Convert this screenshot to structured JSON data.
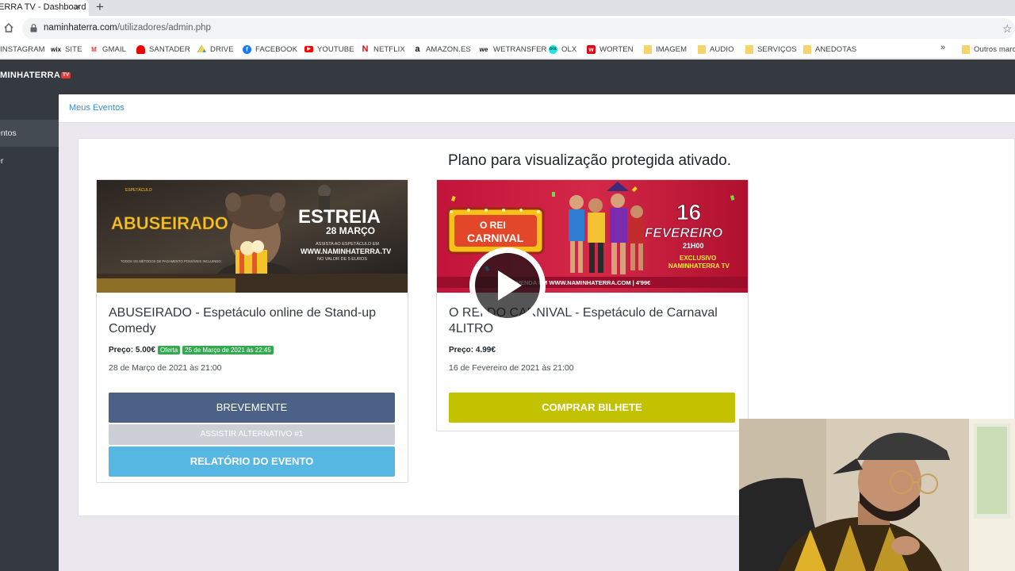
{
  "browser": {
    "tab_title": "ERRA TV - Dashboard",
    "tab_close": "×",
    "new_tab": "+",
    "url_host": "naminhaterra.com",
    "url_path": "/utilizadores/admin.php",
    "bookmarks": [
      "INSTAGRAM",
      "SITE",
      "GMAIL",
      "SANTADER",
      "DRIVE",
      "FACEBOOK",
      "YOUTUBE",
      "NETFLIX",
      "AMAZON.ES",
      "WETRANSFER",
      "OLX",
      "WORTEN",
      "IMAGEM",
      "AUDIO",
      "SERVIÇOS",
      "ANEDOTAS"
    ],
    "bookmarks_more": "»",
    "other_bookmarks": "Outros marc"
  },
  "app": {
    "brand": "MINHATERRA",
    "brand_badge": "TV",
    "sidebar": [
      "entos",
      "er"
    ],
    "breadcrumb": "Meus Eventos",
    "plan_message": "Plano para visualização protegida ativado."
  },
  "events": [
    {
      "title": "ABUSEIRADO - Espetáculo online de Stand-up Comedy",
      "price": "Preço: 5.00€",
      "offer_badge": "Oferta",
      "offer_date": "25 de Março de 2021 às 22:45",
      "date": "28 de Março de 2021 às 21:00",
      "btn_primary": "BREVEMENTE",
      "btn_alt": "ASSISTIR ALTERNATIVO #1",
      "btn_report": "RELATÓRIO DO EVENTO",
      "poster": {
        "title": "ABUSEIRADO",
        "top_label": "ESPETÁCULO",
        "headline": "ESTREIA",
        "subline": "28 MARÇO",
        "small1": "ASSISTA AO ESPETÁCULO EM",
        "site": "WWW.NAMINHATERRA.TV",
        "small2": "NO VALOR DE 5 EUROS",
        "note": "TODOS OS MÉTODOS DE PAGAMENTO POSSÍVEIS INCLUINDO:"
      }
    },
    {
      "title": "O REI DO CARNIVAL - Espetáculo de Carnaval 4LITRO",
      "price": "Preço: 4.99€",
      "date": "16 de Fevereiro de 2021 às 21:00",
      "btn_primary": "COMPRAR BILHETE",
      "poster": {
        "title_top": "O REI",
        "title_bottom": "CARNIVAL",
        "day": "16",
        "month": "FEVEREIRO",
        "time": "21H00",
        "exclusive": "EXCLUSIVO",
        "channel": "NAMINHATERRA TV",
        "site": "VENDA EM WWW.NAMINHATERRA.COM | 4'99€"
      }
    }
  ],
  "colors": {
    "header": "#343a40",
    "link": "#3a8fd3",
    "btn_dark": "#4b6185",
    "btn_blue": "#57b7e3",
    "btn_olive": "#c2c200",
    "badge_green": "#35a852"
  }
}
